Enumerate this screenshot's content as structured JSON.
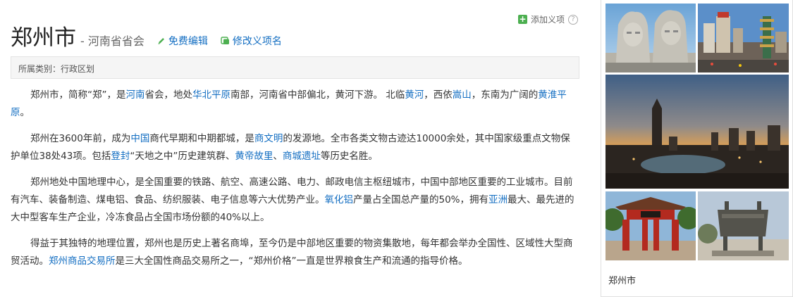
{
  "header": {
    "title": "郑州市",
    "subtitle": "- 河南省省会",
    "edit_label": "免费编辑",
    "rename_label": "修改义项名",
    "add_term_label": "添加义项"
  },
  "category": {
    "text": "所属类别：行政区划"
  },
  "paragraphs": [
    [
      {
        "t": "郑州市，简称“郑”，是"
      },
      {
        "t": "河南",
        "link": true
      },
      {
        "t": "省会，地处"
      },
      {
        "t": "华北平原",
        "link": true
      },
      {
        "t": "南部，河南省中部偏北，黄河下游。 北临"
      },
      {
        "t": "黄河",
        "link": true
      },
      {
        "t": "，西依"
      },
      {
        "t": "嵩山",
        "link": true
      },
      {
        "t": "，东南为广阔的"
      },
      {
        "t": "黄淮平原",
        "link": true
      },
      {
        "t": "。"
      }
    ],
    [
      {
        "t": "郑州在3600年前，成为"
      },
      {
        "t": "中国",
        "link": true
      },
      {
        "t": "商代早期和中期都城，是"
      },
      {
        "t": "商文明",
        "link": true
      },
      {
        "t": "的发源地。全市各类文物古迹达10000余处，其中国家级重点文物保护单位38处43项。包括"
      },
      {
        "t": "登封",
        "link": true
      },
      {
        "t": "“天地之中”历史建筑群、"
      },
      {
        "t": "黄帝故里",
        "link": true
      },
      {
        "t": "、"
      },
      {
        "t": "商城遗址",
        "link": true
      },
      {
        "t": "等历史名胜。"
      }
    ],
    [
      {
        "t": "郑州地处中国地理中心，是全国重要的铁路、航空、高速公路、电力、邮政电信主枢纽城市，中国中部地区重要的工业城市。目前有汽车、装备制造、煤电铝、食品、纺织服装、电子信息等六大优势产业。"
      },
      {
        "t": "氧化铝",
        "link": true
      },
      {
        "t": "产量占全国总产量的50%，拥有"
      },
      {
        "t": "亚洲",
        "link": true
      },
      {
        "t": "最大、最先进的大中型客车生产企业，冷冻食品占全国市场份额的40%以上。"
      }
    ],
    [
      {
        "t": "得益于其独特的地理位置，郑州也是历史上著名商埠，至今仍是中部地区重要的物资集散地，每年都会举办全国性、区域性大型商贸活动。"
      },
      {
        "t": "郑州商品交易所",
        "link": true
      },
      {
        "t": "是三大全国性商品交易所之一，“郑州价格”一直是世界粮食生产和流通的指导价格。"
      }
    ]
  ],
  "sidebar": {
    "caption": "郑州市"
  }
}
